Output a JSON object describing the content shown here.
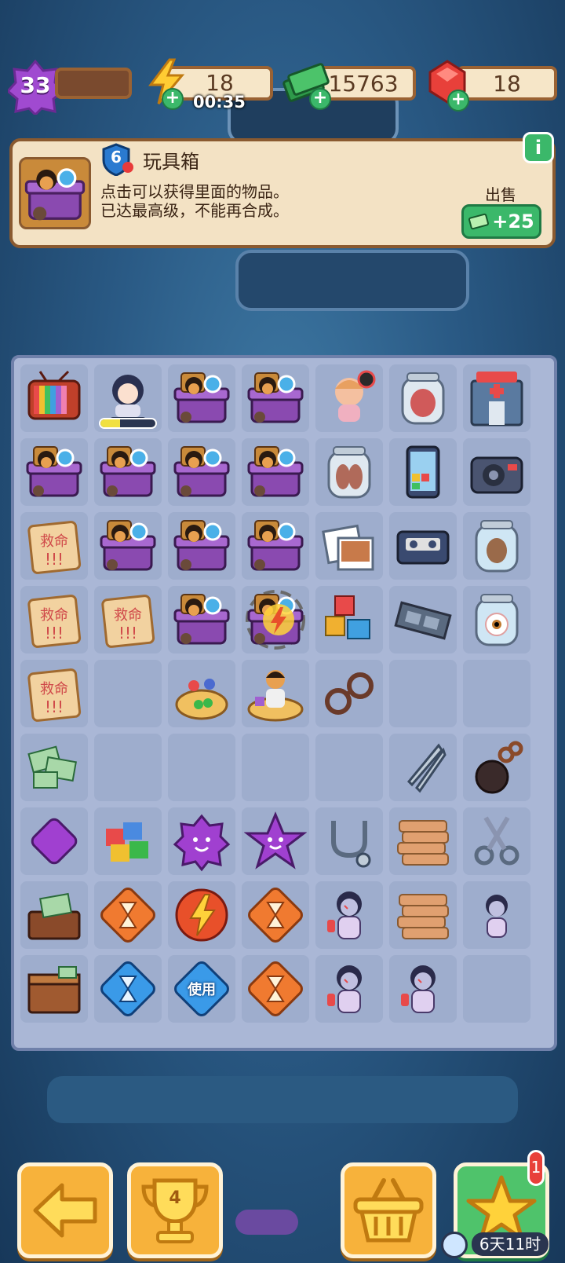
{
  "player": {
    "level": "33"
  },
  "stats": {
    "energy": "18",
    "energy_timer": "00:35",
    "cash": "15763",
    "gems": "18"
  },
  "info_panel": {
    "item_level": "6",
    "title": "玩具箱",
    "line1": "点击可以获得里面的物品。",
    "line2": "已达最高级，不能再合成。",
    "sell_label": "出售",
    "sell_value": "+25",
    "info_glyph": "i"
  },
  "board": {
    "use_label": "使用",
    "rows": [
      [
        "tv",
        "nurse-doll",
        "toy-box",
        "toy-box",
        "girl-doll",
        "heart-jar",
        "hospital-building"
      ],
      [
        "toy-box",
        "toy-box",
        "toy-box",
        "toy-box",
        "lung-jar",
        "smartphone",
        "radio"
      ],
      [
        "help-note",
        "toy-box",
        "toy-box",
        "toy-box",
        "photos",
        "cassette",
        "brain-jar"
      ],
      [
        "help-note",
        "help-note",
        "toy-box",
        "toy-box-selected",
        "cubes",
        "film-strip",
        "eye-jar"
      ],
      [
        "help-note",
        "empty",
        "board-game",
        "kid-on-mat",
        "handcuffs",
        "empty",
        "empty"
      ],
      [
        "cash-notes",
        "empty",
        "empty",
        "empty",
        "empty",
        "tweezers",
        "ball-and-chain"
      ],
      [
        "purple-gem",
        "puzzle-pieces",
        "purple-flower-gem",
        "purple-star-gem",
        "stethoscope",
        "bandage-stack",
        "scissors"
      ],
      [
        "cash-drawer",
        "hourglass-orange",
        "energy-orb",
        "hourglass-orange",
        "nurse-zombie",
        "bandage-stack",
        "nurse-zombie-small"
      ],
      [
        "cash-box",
        "hourglass-blue",
        "hourglass-blue-use",
        "hourglass-orange",
        "nurse-zombie",
        "nurse-zombie",
        "empty"
      ]
    ]
  },
  "bottom_bar": {
    "trophy_count": "4",
    "star_badge": "1",
    "timer": "6天11时"
  },
  "colors": {
    "board_bg": "#aab7d6",
    "panel_bg": "#f3e2c4",
    "button_orange": "#f7b23b",
    "button_green": "#4fc36b",
    "level_purple": "#a04ad0"
  }
}
